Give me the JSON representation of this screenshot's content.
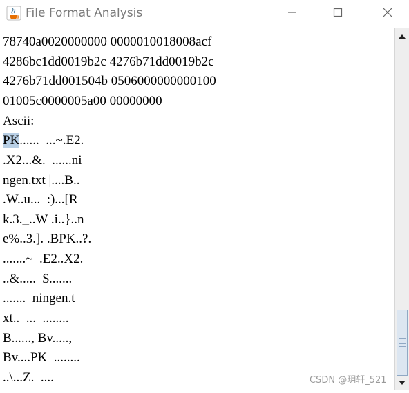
{
  "window": {
    "title": "File Format Analysis",
    "icon": "java-cup-icon",
    "controls": [
      "minimize-icon",
      "maximize-icon",
      "close-icon"
    ]
  },
  "content": {
    "lines": [
      "78740a0020000000 0000010018008acf",
      "4286bc1dd0019b2c 4276b71dd0019b2c",
      "4276b71dd001504b 0506000000000100",
      "01005c0000005a00 00000000",
      "Ascii:",
      "......  ...~.E2.",
      ".X2...&.  ......ni",
      "ngen.txt |....B..",
      ".W..u...  :)...[R",
      "k.3._..W .i..}..n",
      "e%..3.]. .BPK..?.",
      ".......~  .E2..X2.",
      "..&.....  $.......",
      ".......  ningen.t",
      "xt..  ...  ........",
      "B......, Bv.....,",
      "Bv....PK  ........",
      "..\\...Z.  ...."
    ],
    "selected_text": "PK"
  },
  "watermark": "CSDN @玥轩_521",
  "colors": {
    "selection": "#b8cfe5",
    "scroll_thumb": "#dce6f1",
    "title_text": "#7a7a7a"
  }
}
